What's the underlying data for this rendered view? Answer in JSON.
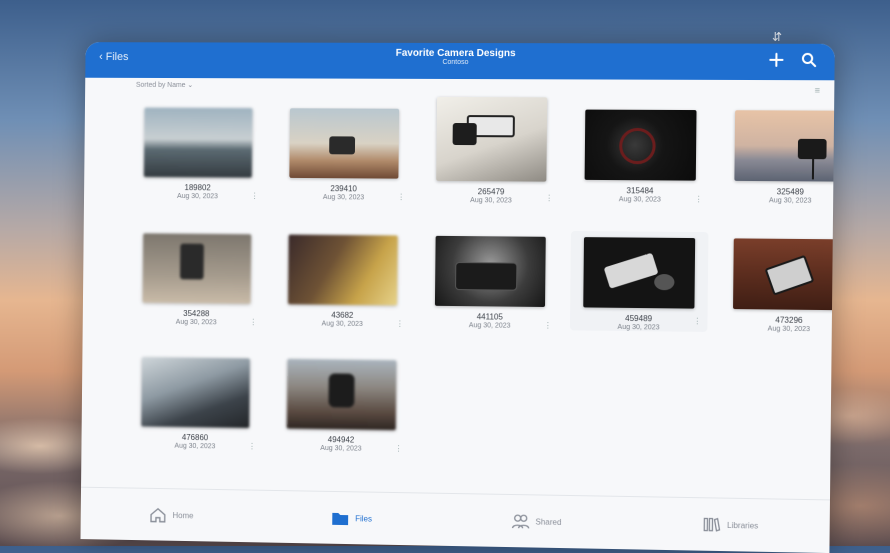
{
  "app": {
    "back_label": "Files",
    "title": "Favorite Camera Designs",
    "subtitle": "Contoso",
    "sort_label": "Sorted by Name ⌄",
    "add_icon": "plus-icon",
    "search_icon": "search-icon"
  },
  "files": [
    {
      "name": "189802",
      "date": "Aug 30, 2023"
    },
    {
      "name": "239410",
      "date": "Aug 30, 2023"
    },
    {
      "name": "265479",
      "date": "Aug 30, 2023"
    },
    {
      "name": "315484",
      "date": "Aug 30, 2023"
    },
    {
      "name": "325489",
      "date": "Aug 30, 2023"
    },
    {
      "name": "354288",
      "date": "Aug 30, 2023"
    },
    {
      "name": "43682",
      "date": "Aug 30, 2023"
    },
    {
      "name": "441105",
      "date": "Aug 30, 2023"
    },
    {
      "name": "459489",
      "date": "Aug 30, 2023"
    },
    {
      "name": "473296",
      "date": "Aug 30, 2023"
    },
    {
      "name": "476860",
      "date": "Aug 30, 2023"
    },
    {
      "name": "494942",
      "date": "Aug 30, 2023"
    }
  ],
  "tabs": [
    {
      "label": "Home",
      "icon": "home-icon"
    },
    {
      "label": "Files",
      "icon": "folder-icon"
    },
    {
      "label": "Shared",
      "icon": "people-icon"
    },
    {
      "label": "Libraries",
      "icon": "library-icon"
    }
  ],
  "colors": {
    "accent": "#1f6fd0"
  }
}
